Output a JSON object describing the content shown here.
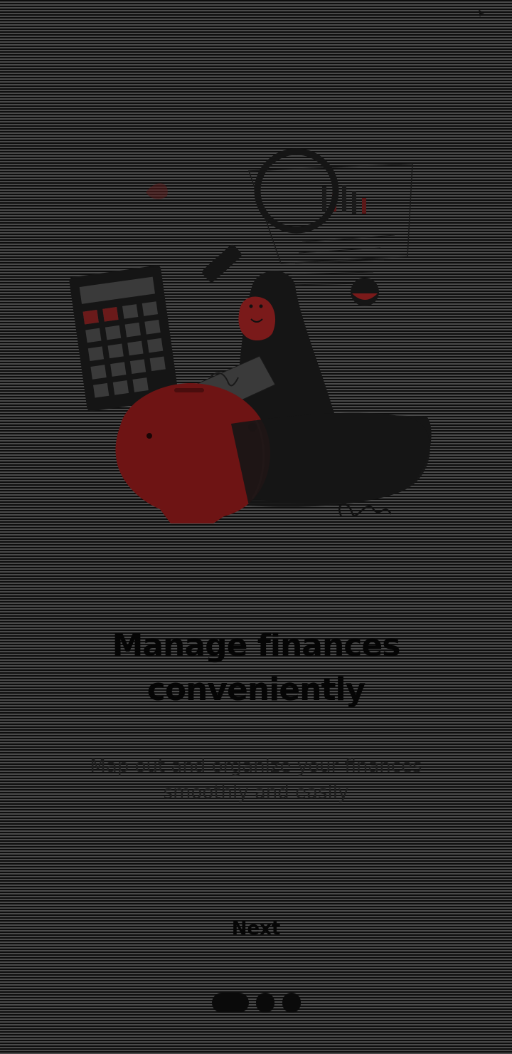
{
  "status_bar": {
    "icon": "location-arrow-icon"
  },
  "onboarding": {
    "illustration": "finance-management-illustration",
    "headline": "Manage finances\nconveniently",
    "subtitle": "Map out and organize your finances\nsmoothly and easily",
    "next_label": "Next",
    "page_indicator": {
      "total_pages": 3,
      "current_page": 1
    }
  },
  "colors": {
    "background": "#404040",
    "piggy_bank": "#6e1414",
    "accent_red": "#7a1a1a",
    "text_primary": "#050505",
    "text_secondary": "#1e1e1e"
  }
}
